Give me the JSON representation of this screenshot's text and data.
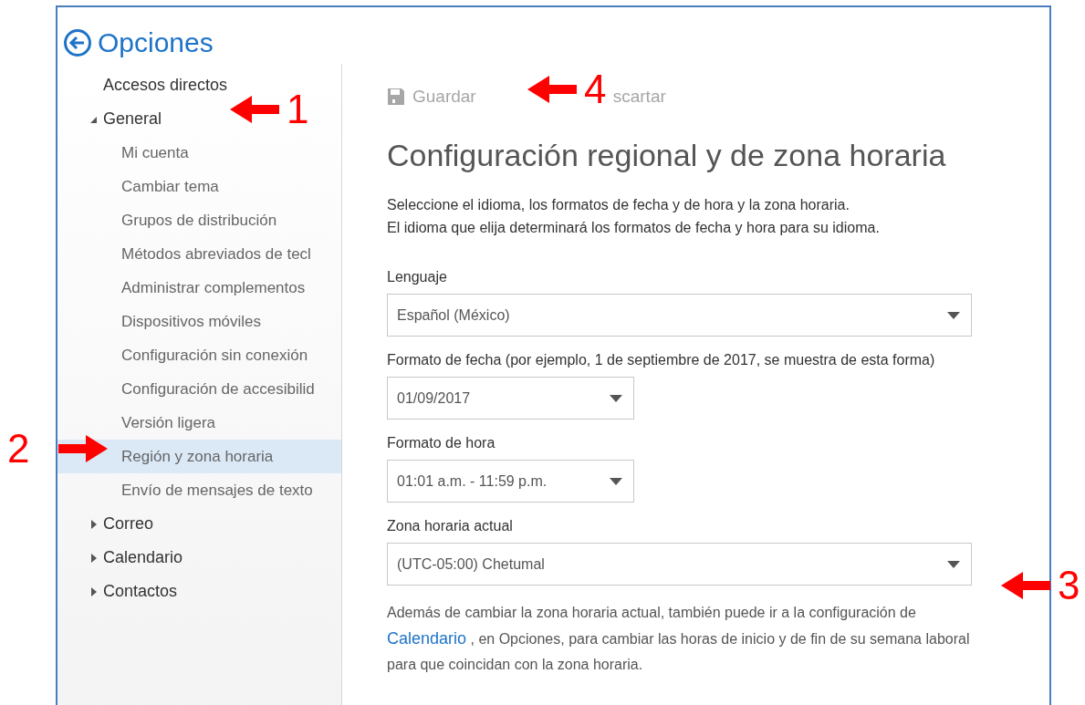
{
  "window": {
    "title": "Opciones"
  },
  "sidebar": {
    "items": [
      {
        "label": "Accesos directos",
        "kind": "link"
      },
      {
        "label": "General",
        "kind": "group",
        "expanded": true,
        "children": [
          {
            "label": "Mi cuenta",
            "selected": false
          },
          {
            "label": "Cambiar tema",
            "selected": false
          },
          {
            "label": "Grupos de distribución",
            "selected": false
          },
          {
            "label": "Métodos abreviados de tecl",
            "selected": false
          },
          {
            "label": "Administrar complementos",
            "selected": false
          },
          {
            "label": "Dispositivos móviles",
            "selected": false
          },
          {
            "label": "Configuración sin conexión",
            "selected": false
          },
          {
            "label": "Configuración de accesibilid",
            "selected": false
          },
          {
            "label": "Versión ligera",
            "selected": false
          },
          {
            "label": "Región y zona horaria",
            "selected": true
          },
          {
            "label": "Envío de mensajes de texto",
            "selected": false
          }
        ]
      },
      {
        "label": "Correo",
        "kind": "group",
        "expanded": false
      },
      {
        "label": "Calendario",
        "kind": "group",
        "expanded": false
      },
      {
        "label": "Contactos",
        "kind": "group",
        "expanded": false
      }
    ]
  },
  "toolbar": [
    {
      "label": "Guardar",
      "kind": "save",
      "disabled": true
    },
    {
      "label": "scartar",
      "kind": "discard",
      "disabled": true
    }
  ],
  "heading": "Configuración regional y de zona horaria",
  "description": [
    "Seleccione el idioma, los formatos de fecha y de hora y la zona horaria.",
    "El idioma que elija determinará los formatos de fecha y hora para su idioma."
  ],
  "fields": [
    {
      "label": "Lenguaje",
      "value": "Español (México)"
    },
    {
      "label": "Formato de fecha (por ejemplo, 1 de septiembre de 2017, se muestra de esta forma)",
      "value": "01/09/2017"
    },
    {
      "label": "Formato de hora",
      "value": "01:01 a.m. - 11:59 p.m."
    },
    {
      "label": "Zona horaria actual",
      "value": "(UTC-05:00) Chetumal"
    }
  ],
  "note": {
    "before": "Además de cambiar la zona horaria actual, también puede ir a la configuración de",
    "link": "Calendario",
    "after": ", en Opciones, para cambiar las horas de inicio y de fin de su semana laboral para que coincidan con la zona horaria."
  },
  "annotations": [
    {
      "label": "1",
      "kind": "arrow-left"
    },
    {
      "label": "2",
      "kind": "arrow-right"
    },
    {
      "label": "3",
      "kind": "arrow-left"
    },
    {
      "label": "4",
      "kind": "arrow-left"
    }
  ]
}
